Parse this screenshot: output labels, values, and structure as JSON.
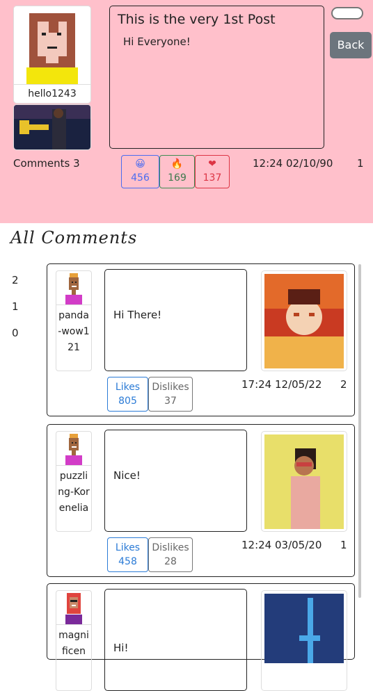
{
  "post": {
    "username": "hello1243",
    "title": "This is the very 1st Post",
    "body": "Hi Everyone!",
    "back_label": "Back",
    "comments_count": "Comments 3",
    "reactions": [
      {
        "icon": "grinning-face-icon",
        "glyph": "😀",
        "count": "456",
        "color": "#4a6cf0"
      },
      {
        "icon": "fire-icon",
        "glyph": "🔥",
        "count": "169",
        "color": "#3d8c52"
      },
      {
        "icon": "heart-icon",
        "glyph": "❤",
        "count": "137",
        "color": "#dc3545"
      }
    ],
    "timestamp": "12:24 02/10/90",
    "number": "1"
  },
  "comments_header": "All Comments",
  "pagination": [
    "2",
    "1",
    "0"
  ],
  "comments": [
    {
      "username": "panda-wow121",
      "text": "Hi There!",
      "likes_label": "Likes",
      "likes": "805",
      "dislikes_label": "Dislikes",
      "dislikes": "37",
      "timestamp": "17:24 12/05/22",
      "number": "2"
    },
    {
      "username": "puzzling-Korenelia",
      "text": "Nice!",
      "likes_label": "Likes",
      "likes": "458",
      "dislikes_label": "Dislikes",
      "dislikes": "28",
      "timestamp": "12:24 03/05/20",
      "number": "1"
    },
    {
      "username": "magnificen",
      "text": "Hi!"
    }
  ]
}
